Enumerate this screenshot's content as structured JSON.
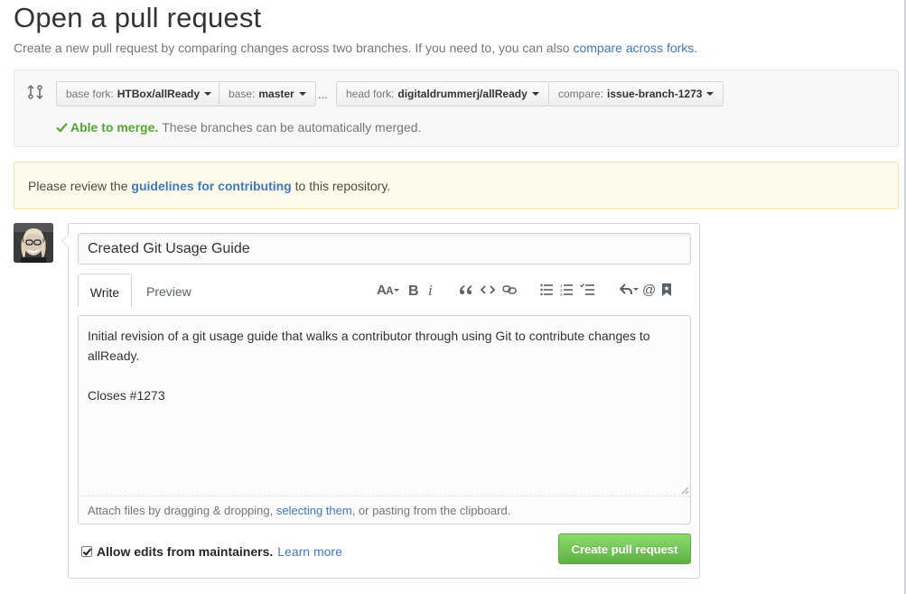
{
  "header": {
    "title": "Open a pull request",
    "subtitle_prefix": "Create a new pull request by comparing changes across two branches. If you need to, you can also",
    "subtitle_link": "compare across forks."
  },
  "range": {
    "base_fork_label": "base fork:",
    "base_fork_value": "HTBox/allReady",
    "base_label": "base:",
    "base_value": "master",
    "separator": "...",
    "head_fork_label": "head fork:",
    "head_fork_value": "digitaldrummerj/allReady",
    "compare_label": "compare:",
    "compare_value": "issue-branch-1273",
    "merge_ok": "Able to merge.",
    "merge_message": "These branches can be automatically merged."
  },
  "flash": {
    "prefix": "Please review the",
    "link": "guidelines for contributing",
    "suffix": "to this repository."
  },
  "form": {
    "title_value": "Created Git Usage Guide",
    "tab_write": "Write",
    "tab_preview": "Preview",
    "body_value": "Initial revision of a git usage guide that walks a contributor through using Git to contribute changes to allReady.\n\nCloses #1273",
    "drop_prefix": "Attach files by dragging & dropping,",
    "drop_link": "selecting them",
    "drop_suffix": ", or pasting from the clipboard.",
    "allow_edits_label": "Allow edits from maintainers.",
    "allow_edits_checked": true,
    "learn_more": "Learn more",
    "submit_label": "Create pull request"
  },
  "toolbar_icons": [
    "header-icon",
    "bold-icon",
    "italic-icon",
    "quote-icon",
    "code-icon",
    "link-icon",
    "unordered-list-icon",
    "ordered-list-icon",
    "task-list-icon",
    "reply-icon",
    "mention-icon",
    "saved-reply-icon"
  ],
  "colors": {
    "accent_link": "#4078c0",
    "merge_green": "#55a532",
    "button_green": "#60b044",
    "flash_bg": "#fffbea"
  }
}
